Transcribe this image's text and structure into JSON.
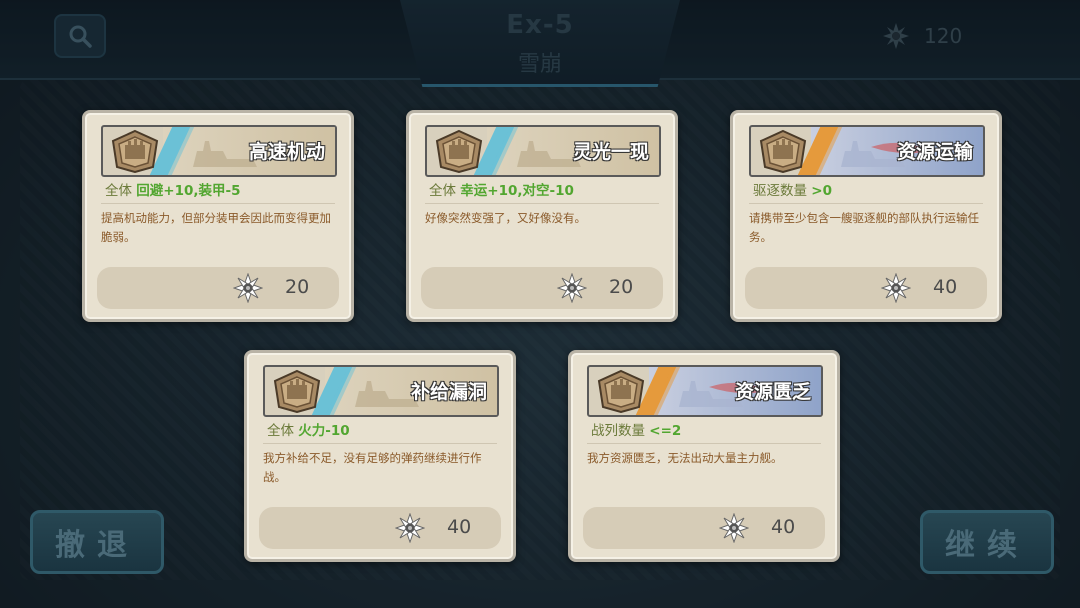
{
  "header": {
    "stage_code": "Ex-5",
    "stage_name": "雪崩",
    "resource_count": "120",
    "search_icon": "search-icon",
    "resource_icon": "gear-flower-icon"
  },
  "cards": [
    {
      "name": "高速机动",
      "effect_prefix": "全体 ",
      "effect_value": "回避+10,装甲-5",
      "description": "提高机动能力，但部分装甲会因此而变得更加脆弱。",
      "cost": "20",
      "accent": "#6bc1d6"
    },
    {
      "name": "灵光一现",
      "effect_prefix": "全体 ",
      "effect_value": "幸运+10,对空-10",
      "description": "好像突然变强了，又好像没有。",
      "cost": "20",
      "accent": "#6bc1d6"
    },
    {
      "name": "资源运输",
      "effect_prefix": "驱逐数量 ",
      "effect_value": ">0",
      "description": "请携带至少包含一艘驱逐舰的部队执行运输任务。",
      "cost": "40",
      "accent": "#e59a3c"
    },
    {
      "name": "补给漏洞",
      "effect_prefix": "全体 ",
      "effect_value": "火力-10",
      "description": "我方补给不足，没有足够的弹药继续进行作战。",
      "cost": "40",
      "accent": "#6bc1d6"
    },
    {
      "name": "资源匮乏",
      "effect_prefix": "战列数量 ",
      "effect_value": "<=2",
      "description": "我方资源匮乏，无法出动大量主力舰。",
      "cost": "40",
      "accent": "#e59a3c"
    }
  ],
  "buttons": {
    "retreat": "撤退",
    "continue": "继续"
  }
}
